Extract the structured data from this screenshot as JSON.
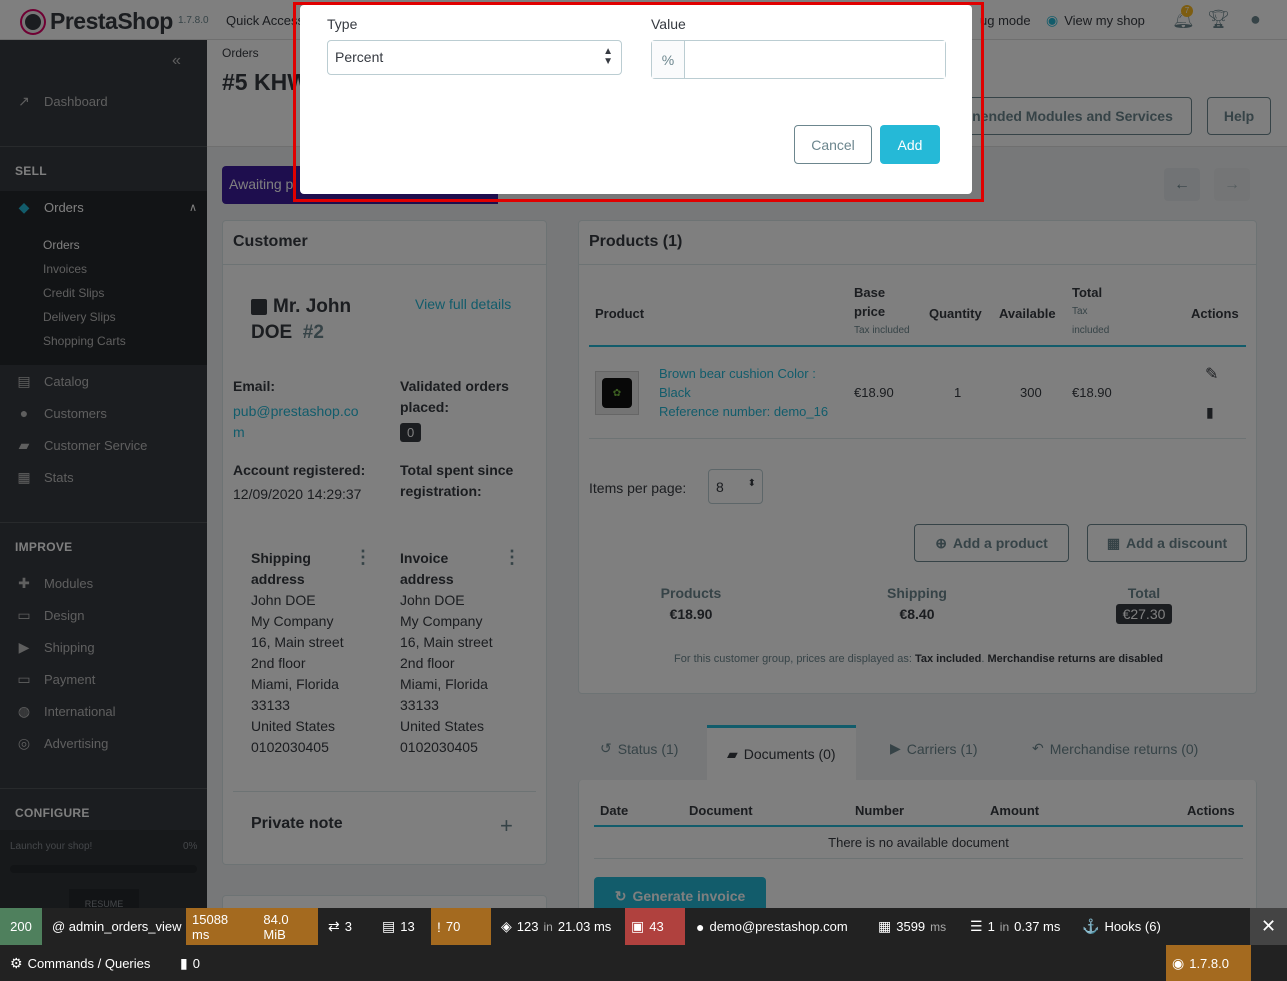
{
  "topbar": {
    "brand": "PrestaShop",
    "version": "1.7.8.0",
    "quick_access": "Quick Access",
    "debug_mode": "ug mode",
    "view_shop": "View my shop",
    "notif_count": "7"
  },
  "sidebar": {
    "dashboard": "Dashboard",
    "sell": "SELL",
    "orders": "Orders",
    "sub": [
      "Orders",
      "Invoices",
      "Credit Slips",
      "Delivery Slips",
      "Shopping Carts"
    ],
    "catalog": "Catalog",
    "customers": "Customers",
    "customer_service": "Customer Service",
    "stats": "Stats",
    "improve": "IMPROVE",
    "modules": "Modules",
    "design": "Design",
    "shipping": "Shipping",
    "payment": "Payment",
    "international": "International",
    "advertising": "Advertising",
    "configure": "CONFIGURE",
    "launch": "Launch your shop!",
    "launch_pct": "0%",
    "resume": "RESUME"
  },
  "header": {
    "breadcrumb": "Orders",
    "title": "#5 KHW",
    "recommended": "nended Modules and Services",
    "help": "Help",
    "status": "Awaiting p"
  },
  "customer": {
    "heading": "Customer",
    "name_line1": "Mr. John",
    "name_line2": "DOE",
    "id": "#2",
    "view_details": "View full details",
    "email_label": "Email:",
    "email_line1": "pub@prestashop.co",
    "email_line2": "m",
    "validated_label1": "Validated orders",
    "validated_label2": "placed:",
    "validated_value": "0",
    "registered_label": "Account registered:",
    "registered_value": "12/09/2020 14:29:37",
    "spent_label1": "Total spent since",
    "spent_label2": "registration:",
    "shipping_title1": "Shipping",
    "shipping_title2": "address",
    "invoice_title1": "Invoice",
    "invoice_title2": "address",
    "address": [
      "John DOE",
      "My Company",
      "16, Main street",
      "2nd floor",
      "Miami, Florida",
      "33133",
      "United States",
      "0102030405"
    ],
    "private_note": "Private note"
  },
  "products": {
    "heading": "Products (1)",
    "columns": {
      "product": "Product",
      "base1": "Base",
      "base2": "price",
      "base_note": "Tax included",
      "quantity": "Quantity",
      "available": "Available",
      "total": "Total",
      "total_note1": "Tax",
      "total_note2": "included",
      "actions": "Actions"
    },
    "row": {
      "name1": "Brown bear cushion Color :",
      "name2": "Black",
      "reference": "Reference number: demo_16",
      "base": "€18.90",
      "quantity": "1",
      "available": "300",
      "total": "€18.90"
    },
    "items_per_page": "Items per page:",
    "per_page_value": "8",
    "add_product": "Add a product",
    "add_discount": "Add a discount",
    "sum_products_label": "Products",
    "sum_products": "€18.90",
    "sum_shipping_label": "Shipping",
    "sum_shipping": "€8.40",
    "sum_total_label": "Total",
    "sum_total": "€27.30",
    "note_prefix": "For this customer group, prices are displayed as:",
    "note_tax": "Tax included",
    "note_returns": "Merchandise returns are disabled"
  },
  "tabs": {
    "status": "Status (1)",
    "documents": "Documents (0)",
    "carriers": "Carriers (1)",
    "returns": "Merchandise returns (0)"
  },
  "documents": {
    "date": "Date",
    "document": "Document",
    "number": "Number",
    "amount": "Amount",
    "actions": "Actions",
    "empty": "There is no available document",
    "generate": "Generate invoice"
  },
  "modal": {
    "type_label": "Type",
    "type_value": "Percent",
    "value_label": "Value",
    "prefix": "%",
    "value_input": "",
    "cancel": "Cancel",
    "add": "Add"
  },
  "debugbar": {
    "status": "200",
    "route": "@ admin_orders_view",
    "time": "15088 ms",
    "memory": "84.0 MiB",
    "twig": "3",
    "forms": "13",
    "warnings": "70",
    "queries": "123",
    "queries_in": "in",
    "queries_time": "21.03 ms",
    "translations": "43",
    "user": "demo@prestashop.com",
    "render": "3599",
    "render_unit": "ms",
    "cache": "1",
    "cache_in": "in",
    "cache_time": "0.37 ms",
    "hooks": "Hooks (6)",
    "commands": "Commands / Queries",
    "extra": "0",
    "ps_version": "1.7.8.0"
  },
  "colors": {
    "accent": "#25b9d7",
    "sidebar": "#363a41",
    "status": "#3c1d9d",
    "highlight": "#e00000"
  }
}
